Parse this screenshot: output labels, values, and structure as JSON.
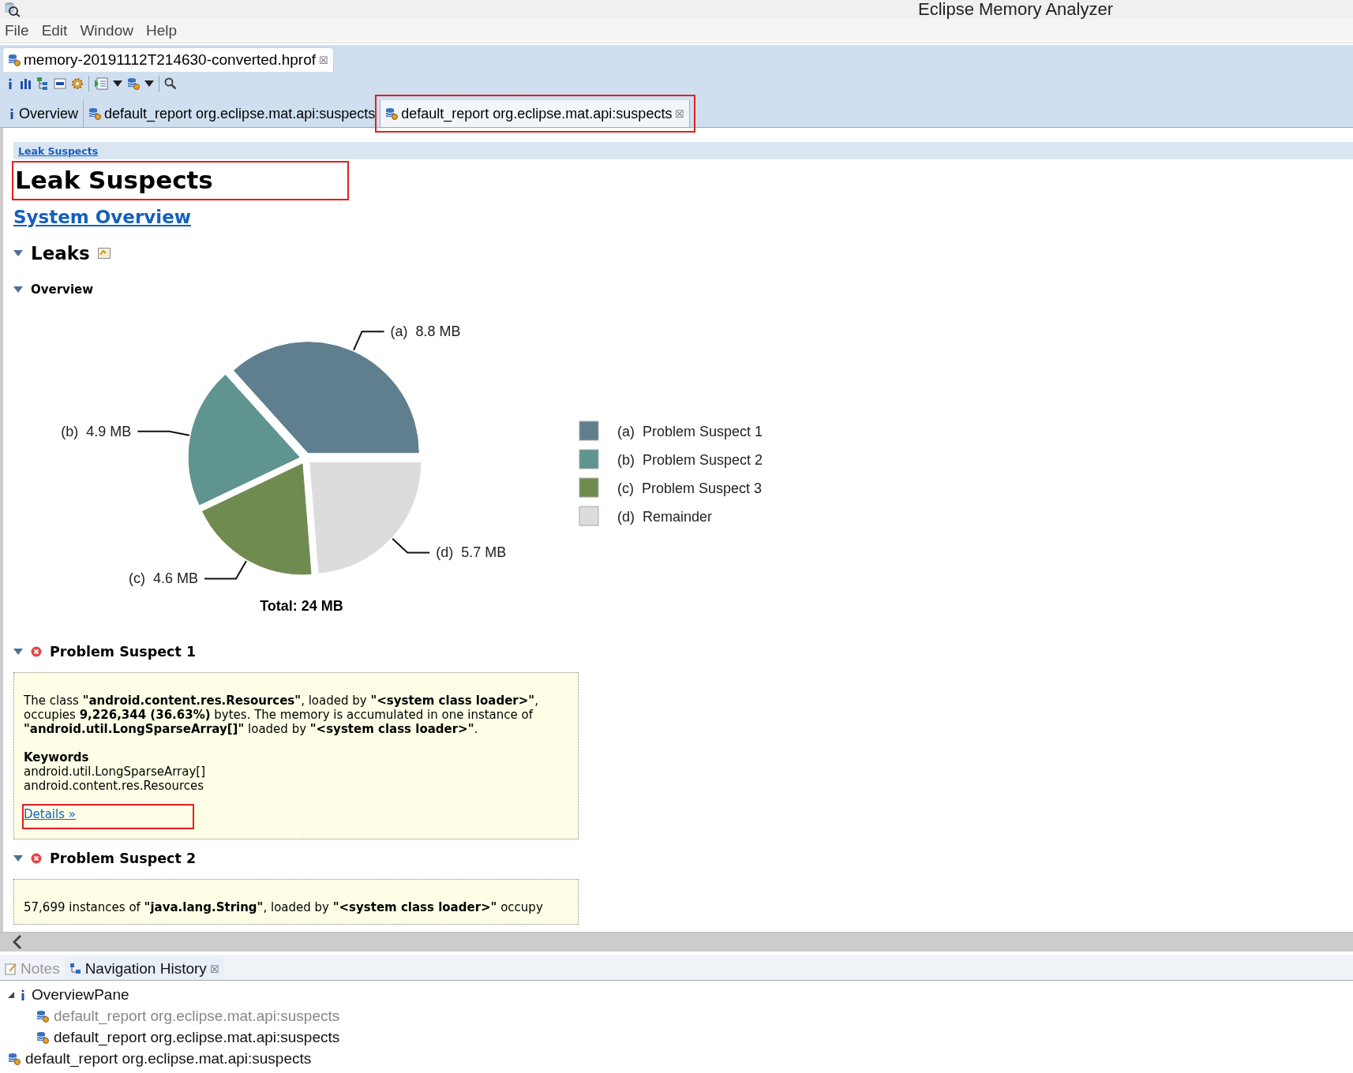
{
  "window": {
    "title": "Eclipse Memory Analyzer"
  },
  "menu": [
    "File",
    "Edit",
    "Window",
    "Help"
  ],
  "editor_tab": {
    "label": "memory-20191112T214630-converted.hprof",
    "close": "☒"
  },
  "toolbar": [
    {
      "kind": "info"
    },
    {
      "kind": "histogram"
    },
    {
      "kind": "tree"
    },
    {
      "kind": "oql"
    },
    {
      "kind": "gear"
    },
    {
      "kind": "sep"
    },
    {
      "kind": "report"
    },
    {
      "kind": "caret"
    },
    {
      "kind": "db"
    },
    {
      "kind": "caret"
    },
    {
      "kind": "sep"
    },
    {
      "kind": "search"
    }
  ],
  "tabs": [
    {
      "kind": "info",
      "label": "Overview",
      "selected": false,
      "highlighted": false
    },
    {
      "kind": "db",
      "label": "default_report  org.eclipse.mat.api:suspects",
      "selected": false,
      "highlighted": false
    },
    {
      "kind": "db",
      "label": "default_report  org.eclipse.mat.api:suspects",
      "selected": true,
      "highlighted": true,
      "close": "☒"
    }
  ],
  "breadcrumb": "Leak Suspects",
  "page_title": {
    "text": "Leak Suspects",
    "highlighted": true
  },
  "system_overview_link": "System Overview",
  "leaks": {
    "title": "Leaks",
    "expanded": true
  },
  "overview": {
    "title": "Overview",
    "expanded": true,
    "chart_data": {
      "type": "pie",
      "title": "Total: 24 MB",
      "categories": [
        "(a)  Problem Suspect 1",
        "(b)  Problem Suspect 2",
        "(c)  Problem Suspect 3",
        "(d)  Remainder"
      ],
      "values": [
        8.8,
        4.9,
        4.6,
        5.7
      ],
      "colors": [
        "#5f7e8e",
        "#5f9490",
        "#6f8b50",
        "#dcdcdc"
      ],
      "value_labels": [
        "(a)  8.8 MB",
        "(b)  4.9 MB",
        "(c)  4.6 MB",
        "(d)  5.7 MB"
      ],
      "legend": true
    }
  },
  "suspects": [
    {
      "title": "Problem Suspect 1",
      "expanded": true,
      "text": "The class **\"android.content.res.Resources\"**, loaded by **\"<system class loader>\"**, occupies **9,226,344 (36.63%)** bytes. The memory is accumulated in one instance of **\"android.util.LongSparseArray[]\"** loaded by **\"<system class loader>\"**.",
      "keywords_title": "Keywords",
      "keywords": [
        "android.util.LongSparseArray[]",
        "android.content.res.Resources"
      ],
      "details": {
        "label": "Details »",
        "highlighted": true
      }
    },
    {
      "title": "Problem Suspect 2",
      "expanded": true,
      "text": "57,699 instances of **\"java.lang.String\"**, loaded by **\"<system class loader>\"** occupy"
    }
  ],
  "bottom_tabs": [
    {
      "kind": "notes",
      "label": "Notes",
      "selected": false
    },
    {
      "kind": "history",
      "label": "Navigation History",
      "selected": true,
      "close": "☒"
    }
  ],
  "history": [
    {
      "kind": "info",
      "label": "OverviewPane",
      "greyed": false,
      "expanded": true,
      "children": [
        {
          "kind": "db",
          "label": "default_report  org.eclipse.mat.api:suspects",
          "greyed": true
        },
        {
          "kind": "db",
          "label": "default_report  org.eclipse.mat.api:suspects",
          "greyed": false
        }
      ]
    },
    {
      "kind": "db",
      "label": "default_report  org.eclipse.mat.api:suspects",
      "greyed": false
    }
  ]
}
